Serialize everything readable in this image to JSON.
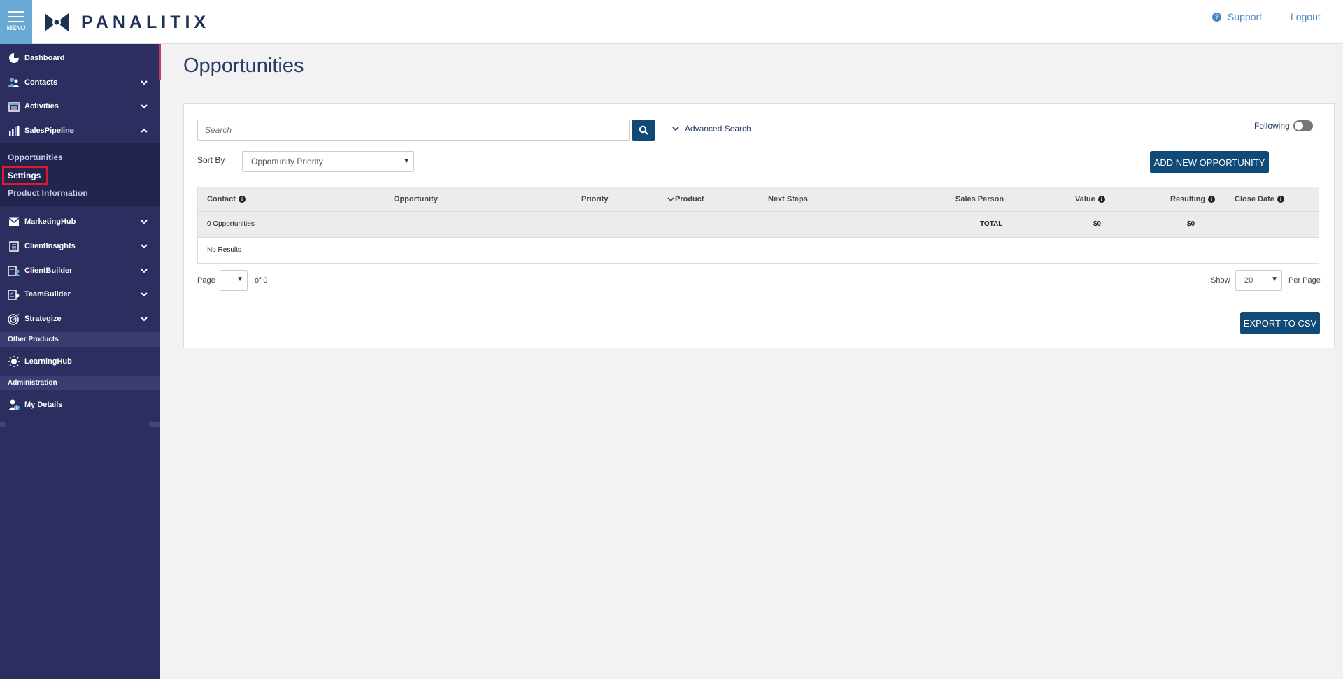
{
  "header": {
    "menu_label": "MENU",
    "logo_text": "PANALITIX",
    "support_label": "Support",
    "logout_label": "Logout"
  },
  "sidebar": {
    "items": [
      {
        "label": "Dashboard",
        "icon": "pie-chart-icon",
        "expandable": false
      },
      {
        "label": "Contacts",
        "icon": "users-icon",
        "expandable": true
      },
      {
        "label": "Activities",
        "icon": "calendar-icon",
        "expandable": true
      },
      {
        "label": "SalesPipeline",
        "icon": "bar-chart-icon",
        "expandable": true,
        "expanded": true
      },
      {
        "label": "MarketingHub",
        "icon": "envelope-icon",
        "expandable": true
      },
      {
        "label": "ClientInsights",
        "icon": "clipboard-icon",
        "expandable": true
      },
      {
        "label": "ClientBuilder",
        "icon": "clipboard-user-icon",
        "expandable": true
      },
      {
        "label": "TeamBuilder",
        "icon": "checklist-icon",
        "expandable": true
      },
      {
        "label": "Strategize",
        "icon": "target-icon",
        "expandable": true
      }
    ],
    "sales_pipeline_sub": [
      "Opportunities",
      "Settings",
      "Product Information"
    ],
    "highlighted_sub": "Settings",
    "other_products_header": "Other Products",
    "learning_hub_label": "LearningHub",
    "administration_header": "Administration",
    "my_details_label": "My Details"
  },
  "main": {
    "title": "Opportunities",
    "search_placeholder": "Search",
    "advanced_search_label": "Advanced Search",
    "following_label": "Following",
    "sort_by_label": "Sort By",
    "sort_by_value": "Opportunity Priority",
    "add_button_label": "ADD NEW OPPORTUNITY",
    "columns": [
      "Contact",
      "Opportunity",
      "Priority",
      "Product",
      "Next Steps",
      "Sales Person",
      "Value",
      "Resulting",
      "Close Date"
    ],
    "totals": {
      "count_label": "0 Opportunities",
      "total_label": "TOTAL",
      "value_total": "$0",
      "resulting_total": "$0"
    },
    "no_results_label": "No Results",
    "pager": {
      "page_label": "Page",
      "of_label": "of 0",
      "show_label": "Show",
      "per_page_value": "20",
      "per_page_label": "Per Page"
    },
    "export_label": "EXPORT TO CSV"
  },
  "colors": {
    "sidebar_bg": "#2b2e5e",
    "brand_blue": "#0f4a78",
    "menu_blue": "#6aa9d4",
    "highlight_red": "#e3182d"
  }
}
